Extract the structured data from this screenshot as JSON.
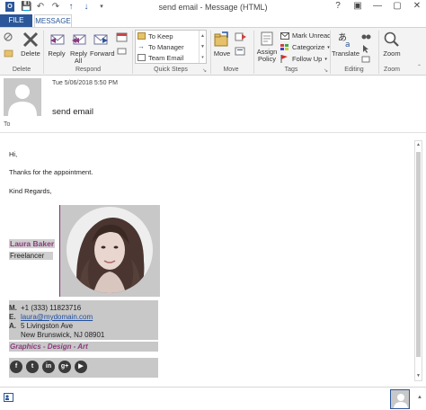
{
  "window": {
    "title": "send email - Message (HTML)",
    "qat_icons": [
      "outlook-icon",
      "save-icon",
      "undo-icon",
      "redo-icon",
      "up-arrow-icon",
      "down-arrow-icon",
      "customize-qat-icon"
    ],
    "controls": [
      "?",
      "▣",
      "—",
      "▢",
      "✕"
    ]
  },
  "tabs": {
    "file": "FILE",
    "message": "MESSAGE"
  },
  "ribbon": {
    "delete_group": {
      "label": "Delete",
      "delete": "Delete"
    },
    "respond_group": {
      "label": "Respond",
      "reply": "Reply",
      "reply_all": "Reply All",
      "forward": "Forward"
    },
    "quick_steps_group": {
      "label": "Quick Steps",
      "items": [
        "To Keep",
        "To Manager",
        "Team Email"
      ]
    },
    "move_group": {
      "label": "Move",
      "move": "Move"
    },
    "tags_group": {
      "label": "Tags",
      "assign_policy": "Assign Policy",
      "mark_unread": "Mark Unread",
      "categorize": "Categorize",
      "follow_up": "Follow Up"
    },
    "editing_group": {
      "label": "Editing",
      "translate": "Translate"
    },
    "zoom_group": {
      "label": "Zoom",
      "zoom": "Zoom"
    }
  },
  "header": {
    "date": "Tue 5/06/2018 5:50 PM",
    "subject": "send email",
    "to_label": "To"
  },
  "body": {
    "greeting": "Hi,",
    "line1": "Thanks for the appointment.",
    "closing": "Kind Regards,"
  },
  "signature": {
    "name": "Laura Baker",
    "role": "Freelancer",
    "mobile_key": "M.",
    "mobile": "+1 (333) 11823716",
    "email_key": "E.",
    "email": "laura@mydomain.com",
    "address_key": "A.",
    "address_line1": "5 Livingston Ave",
    "address_line2": "New Brunswick, NJ 08901",
    "tagline": "Graphics - Design - Art",
    "social": [
      {
        "icon": "facebook-icon",
        "glyph": "f"
      },
      {
        "icon": "twitter-icon",
        "glyph": "t"
      },
      {
        "icon": "linkedin-icon",
        "glyph": "in"
      },
      {
        "icon": "google-plus-icon",
        "glyph": "g+"
      },
      {
        "icon": "youtube-icon",
        "glyph": "▶"
      }
    ],
    "accent_color": "#8b3a7d",
    "link_color": "#1f4e9e"
  },
  "colors": {
    "brand": "#2b579a"
  }
}
